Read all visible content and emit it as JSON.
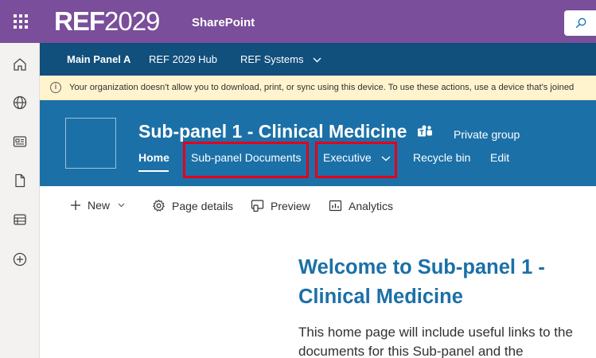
{
  "suite": {
    "logo_bold": "REF",
    "logo_light": "2029",
    "app_title": "SharePoint"
  },
  "hub_nav": {
    "items": [
      {
        "label": "Main Panel A"
      },
      {
        "label": "REF 2029 Hub"
      },
      {
        "label": "REF Systems"
      }
    ]
  },
  "warning": {
    "icon": "info-icon",
    "text": "Your organization doesn't allow you to download, print, or sync using this device. To use these actions, use a device that's joined"
  },
  "site": {
    "title": "Sub-panel 1 - Clinical Medicine",
    "group_label": "Private group",
    "nav": [
      {
        "label": "Home"
      },
      {
        "label": "Sub-panel Documents"
      },
      {
        "label": "Executive"
      },
      {
        "label": "Recycle bin"
      },
      {
        "label": "Edit"
      }
    ],
    "highlight_color": "#e3001b"
  },
  "commands": [
    {
      "label": "New",
      "icon": "plus-icon"
    },
    {
      "label": "Page details",
      "icon": "gear-icon"
    },
    {
      "label": "Preview",
      "icon": "preview-icon"
    },
    {
      "label": "Analytics",
      "icon": "analytics-icon"
    }
  ],
  "content": {
    "welcome_title": "Welcome to Sub-panel 1 - Clinical Medicine",
    "welcome_body": "This home page will include useful links to the documents for this Sub-panel and the"
  },
  "colors": {
    "suite_bar": "#7a4e9a",
    "hub_nav": "#114f7c",
    "site_header": "#1b70a7",
    "warning_bg": "#fff4ce"
  }
}
